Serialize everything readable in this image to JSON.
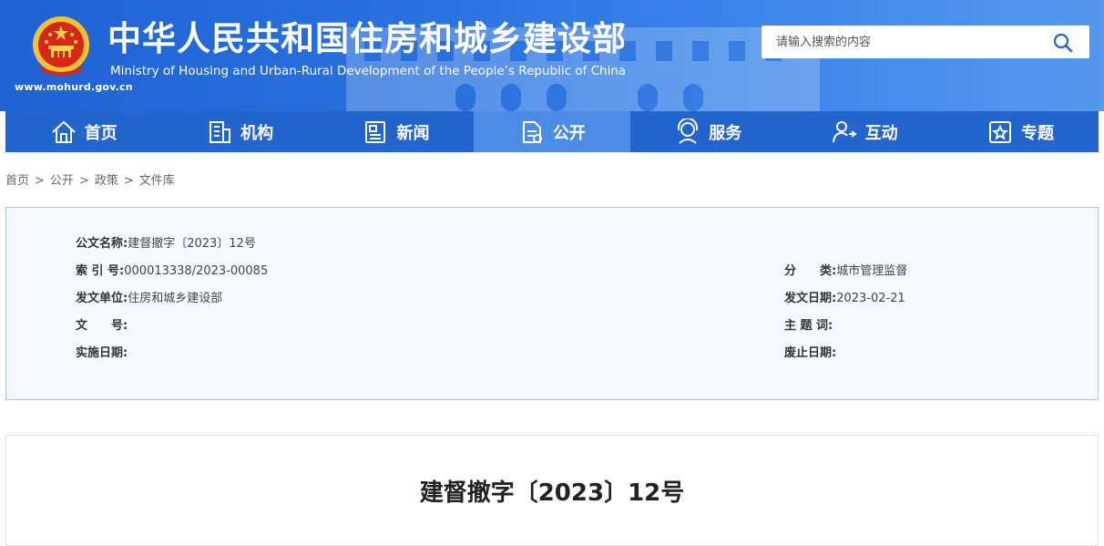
{
  "header": {
    "title": "中华人民共和国住房和城乡建设部",
    "subtitle": "Ministry of Housing and Urban-Rural Development of the People’s Republic of China",
    "url": "www.mohurd.gov.cn",
    "search_placeholder": "请输入搜索的内容"
  },
  "nav": {
    "items": [
      {
        "label": "首页",
        "icon": "home-icon"
      },
      {
        "label": "机构",
        "icon": "building-icon"
      },
      {
        "label": "新闻",
        "icon": "newspaper-icon"
      },
      {
        "label": "公开",
        "icon": "document-icon",
        "active": true
      },
      {
        "label": "服务",
        "icon": "service-icon"
      },
      {
        "label": "互动",
        "icon": "interaction-icon"
      },
      {
        "label": "专题",
        "icon": "star-box-icon"
      }
    ]
  },
  "breadcrumb": [
    "首页",
    "公开",
    "政策",
    "文件库"
  ],
  "info": {
    "doc_name_label": "公文名称:",
    "doc_name": "建督撤字〔2023〕12号",
    "index_label": "索 引 号:",
    "index": "000013338/2023-00085",
    "category_label": "分　　类:",
    "category": "城市管理监督",
    "issuer_label": "发文单位:",
    "issuer": "住房和城乡建设部",
    "issue_date_label": "发文日期:",
    "issue_date": "2023-02-21",
    "doc_no_label": "文　　号:",
    "doc_no": "",
    "keywords_label": "主 题 词:",
    "keywords": "",
    "effective_label": "实施日期:",
    "effective": "",
    "abolish_label": "废止日期:",
    "abolish": ""
  },
  "document": {
    "title": "建督撤字〔2023〕12号"
  },
  "colors": {
    "header_blue": "#2a72e0",
    "nav_blue": "#2265cc",
    "nav_active": "#4b8ce6",
    "info_border": "#a9c3e6",
    "info_bg": "#f5f9fe"
  }
}
